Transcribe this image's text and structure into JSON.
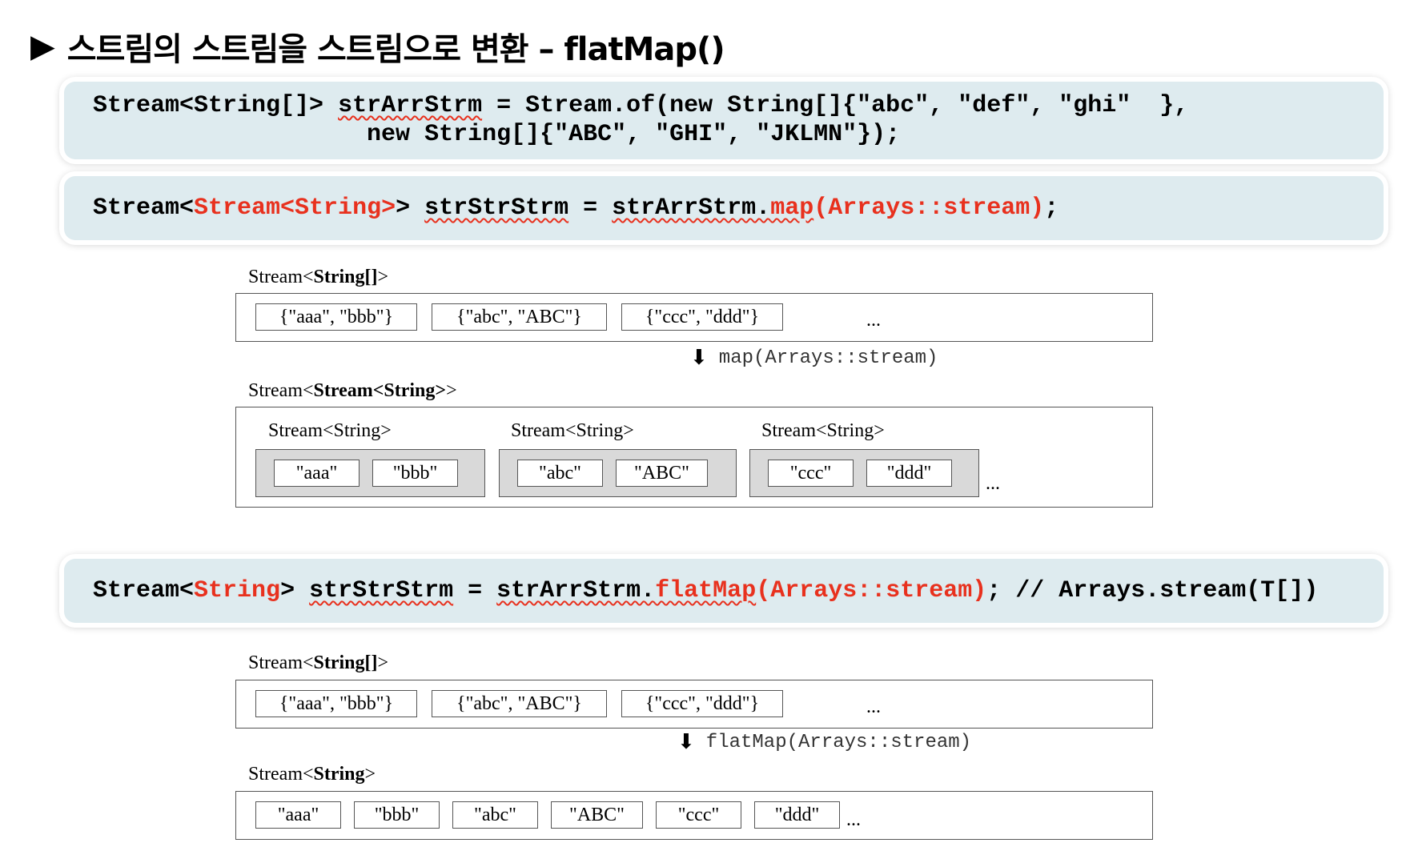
{
  "title": {
    "marker": "▶",
    "text": "스트림의 스트림을  스트림으로 변환 –  flatMap()"
  },
  "code1": {
    "l1_a": "Stream<String[]> ",
    "l1_var": "strArrStrm",
    "l1_b": " = Stream.of(new String[]{\"abc\", \"def\", \"ghi\"  },",
    "l2": "                   new String[]{\"ABC\", \"GHI\", \"JKLMN\"});"
  },
  "code2": {
    "a": "Stream<",
    "red1": "Stream<String>",
    "b": "> ",
    "var1": "strStrStrm",
    "c": " = ",
    "var2": "strArrStrm.",
    "red2": "map",
    "red3": "(Arrays::stream)",
    "d": ";"
  },
  "code3": {
    "a": "Stream<",
    "red1": "String",
    "b": "> ",
    "var1": "strStrStrm",
    "c": " = ",
    "var2": "strArrStrm.",
    "red2": "flatMap",
    "red3": "(Arrays::stream)",
    "d": "; // Arrays.stream(T[])"
  },
  "diagram1": {
    "top_label_pre": "Stream<",
    "top_label_bold": "String[]",
    "top_label_post": ">",
    "top_cells": [
      "{\"aaa\", \"bbb\"}",
      "{\"abc\", \"ABC\"}",
      "{\"ccc\", \"ddd\"}"
    ],
    "ellipsis": "...",
    "arrow": "⬇",
    "op": "map(Arrays::stream)",
    "bottom_label_pre": "Stream<",
    "bottom_label_bold": "Stream<String>",
    "bottom_label_post": ">",
    "groups": [
      {
        "label": "Stream<String>",
        "items": [
          "\"aaa\"",
          "\"bbb\""
        ]
      },
      {
        "label": "Stream<String>",
        "items": [
          "\"abc\"",
          "\"ABC\""
        ]
      },
      {
        "label": "Stream<String>",
        "items": [
          "\"ccc\"",
          "\"ddd\""
        ]
      }
    ]
  },
  "diagram2": {
    "top_label_pre": "Stream<",
    "top_label_bold": "String[]",
    "top_label_post": ">",
    "top_cells": [
      "{\"aaa\", \"bbb\"}",
      "{\"abc\", \"ABC\"}",
      "{\"ccc\", \"ddd\"}"
    ],
    "ellipsis": "...",
    "arrow": "⬇",
    "op": "flatMap(Arrays::stream)",
    "bottom_label_pre": "Stream<",
    "bottom_label_bold": "String",
    "bottom_label_post": ">",
    "items": [
      "\"aaa\"",
      "\"bbb\"",
      "\"abc\"",
      "\"ABC\"",
      "\"ccc\"",
      "\"ddd\""
    ]
  }
}
